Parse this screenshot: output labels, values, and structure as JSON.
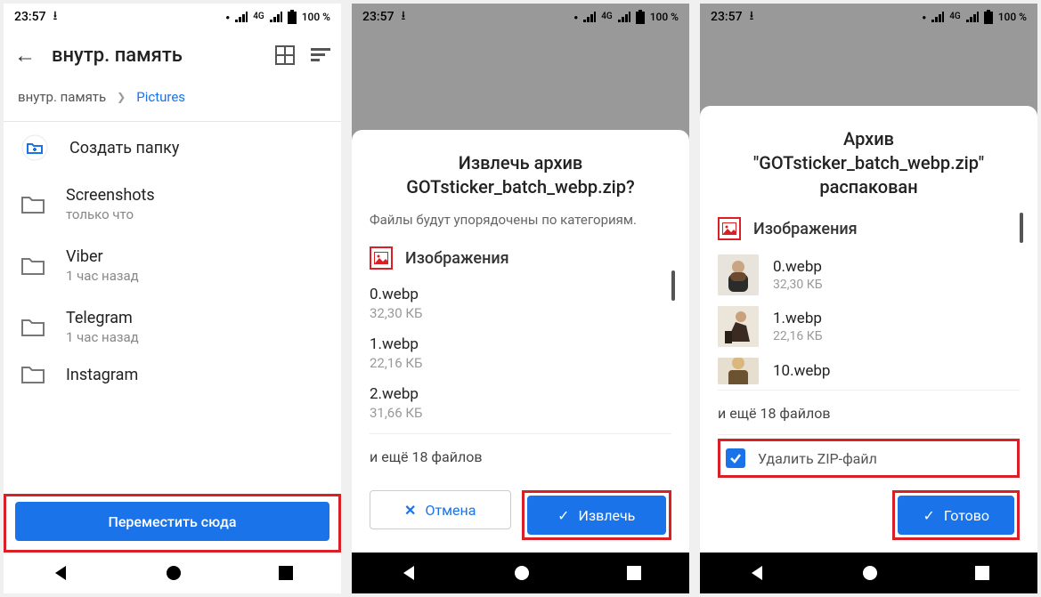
{
  "status": {
    "time": "23:57",
    "network": "4G",
    "battery": "100 %"
  },
  "screen1": {
    "title": "внутр. память",
    "breadcrumb": {
      "root": "внутр. память",
      "current": "Pictures"
    },
    "create_folder": "Создать папку",
    "folders": [
      {
        "name": "Screenshots",
        "sub": "только что"
      },
      {
        "name": "Viber",
        "sub": "1 час назад"
      },
      {
        "name": "Telegram",
        "sub": "1 час назад"
      },
      {
        "name": "Instagram",
        "sub": ""
      }
    ],
    "move_here": "Переместить сюда"
  },
  "screen2": {
    "title_line1": "Извлечь архив",
    "title_line2": "GOTsticker_batch_webp.zip?",
    "subtitle": "Файлы будут упорядочены по категориям.",
    "category": "Изображения",
    "files": [
      {
        "name": "0.webp",
        "size": "32,30 КБ"
      },
      {
        "name": "1.webp",
        "size": "22,16 КБ"
      },
      {
        "name": "2.webp",
        "size": "31,66 КБ"
      }
    ],
    "more": "и ещё 18 файлов",
    "cancel": "Отмена",
    "extract": "Извлечь"
  },
  "screen3": {
    "title_line1": "Архив",
    "title_line2": "\"GOTsticker_batch_webp.zip\"",
    "title_line3": "распакован",
    "category": "Изображения",
    "files": [
      {
        "name": "0.webp",
        "size": "32,30 КБ"
      },
      {
        "name": "1.webp",
        "size": "22,16 КБ"
      },
      {
        "name": "10.webp",
        "size": ""
      }
    ],
    "more": "и ещё 18 файлов",
    "delete_zip": "Удалить ZIP-файл",
    "done": "Готово"
  }
}
